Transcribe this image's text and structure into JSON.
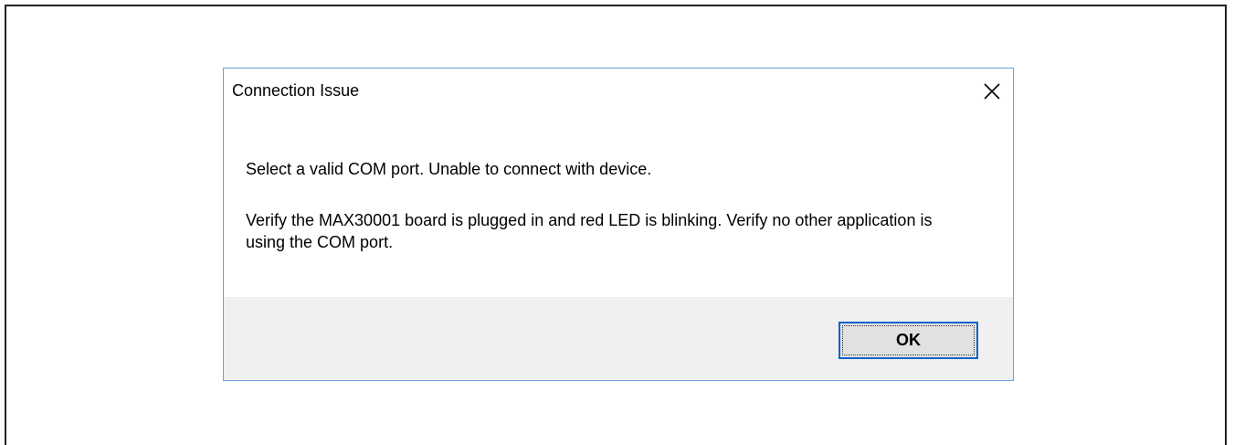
{
  "dialog": {
    "title": "Connection Issue",
    "close_icon": "close-icon",
    "message_line1": "Select a valid COM port. Unable to connect with device.",
    "message_line2": "Verify the MAX30001 board is plugged in and red LED is blinking. Verify no other application is using the COM port.",
    "ok_label": "OK"
  },
  "colors": {
    "dialog_border": "#6ea0d8",
    "footer_bg": "#f0f0f0",
    "button_focus_border": "#0a64c8"
  }
}
